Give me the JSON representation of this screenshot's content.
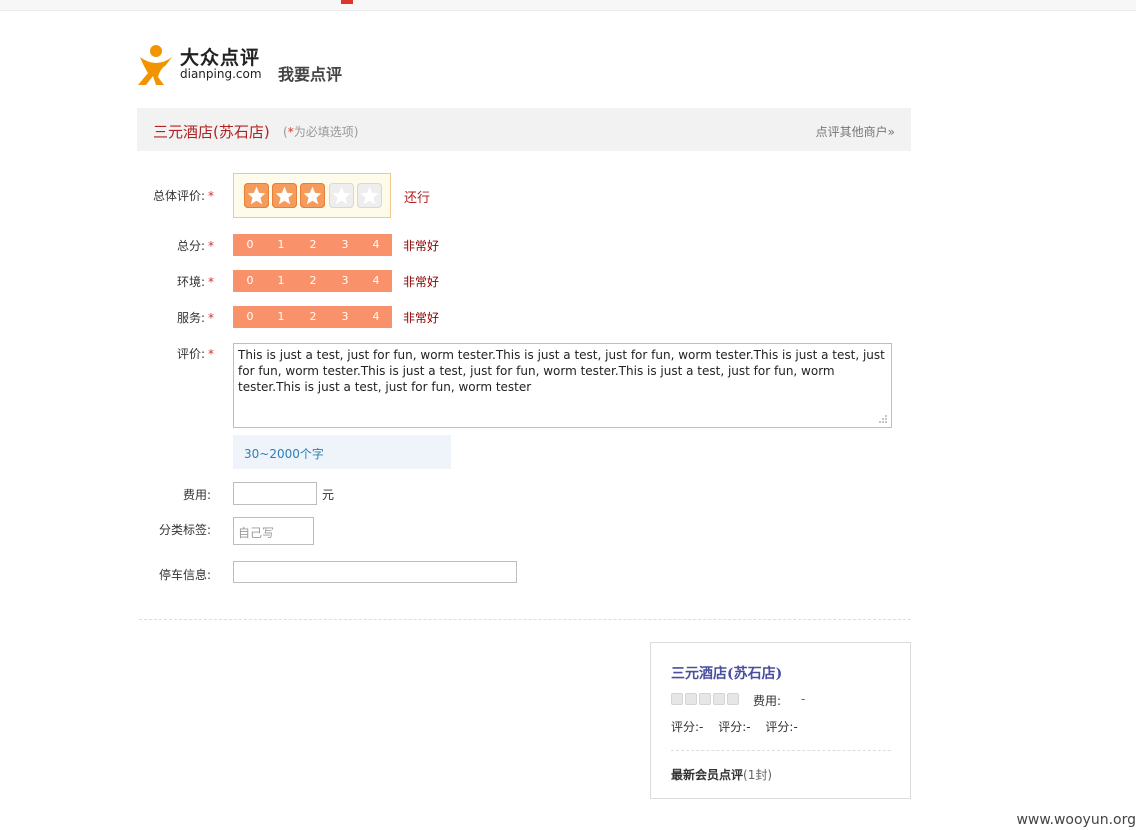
{
  "brand": {
    "logo_cn": "大众点评",
    "logo_en": "dianping.com",
    "page_title": "我要点评"
  },
  "header": {
    "shop_name": "三元酒店(苏石店)",
    "required_note_open": "(",
    "required_note_star": "*",
    "required_note_text": "为必填选项)",
    "other_link": "点评其他商户»"
  },
  "form": {
    "overall": {
      "label": "总体评价:",
      "required_mark": "*",
      "stars_total": 5,
      "stars_selected": 3,
      "rating_text": "还行"
    },
    "scores": [
      {
        "label": "总分:",
        "required_mark": "*",
        "options": [
          "0",
          "1",
          "2",
          "3",
          "4"
        ],
        "selected_text": "非常好"
      },
      {
        "label": "环境:",
        "required_mark": "*",
        "options": [
          "0",
          "1",
          "2",
          "3",
          "4"
        ],
        "selected_text": "非常好"
      },
      {
        "label": "服务:",
        "required_mark": "*",
        "options": [
          "0",
          "1",
          "2",
          "3",
          "4"
        ],
        "selected_text": "非常好"
      }
    ],
    "review": {
      "label": "评价:",
      "required_mark": "*",
      "value": "This is just a test, just for fun, worm tester.This is just a test, just for fun, worm tester.This is just a test, just for fun, worm tester.This is just a test, just for fun, worm tester.This is just a test, just for fun, worm tester.This is just a test, just for fun, worm tester",
      "char_hint": "30~2000个字"
    },
    "fee": {
      "label": "费用:",
      "value": "",
      "unit": "元"
    },
    "tags": {
      "label": "分类标签:",
      "placeholder": "自己写"
    },
    "parking": {
      "label": "停车信息:",
      "value": ""
    }
  },
  "sidebar_card": {
    "shop_name": "三元酒店(苏石店)",
    "stars_total": 5,
    "fee_label": "费用:",
    "fee_value": "-",
    "scores": [
      "评分:-",
      "评分:-",
      "评分:-"
    ],
    "latest_label": "最新会员点评",
    "latest_count": "(1封)"
  },
  "watermark": "www.wooyun.org",
  "colors": {
    "accent_red": "#b22222",
    "score_bar": "#f9916a",
    "star_on": "#f59b5b",
    "hint_blue": "#2f7fb5",
    "card_title": "#4a4e9f"
  }
}
